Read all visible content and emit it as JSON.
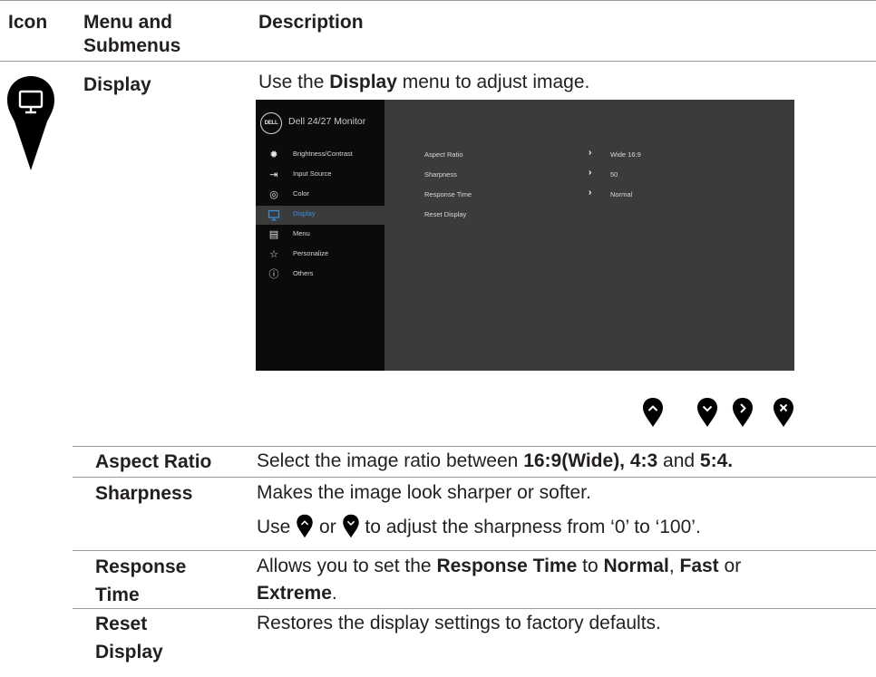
{
  "header": {
    "col_icon": "Icon",
    "col_menu": "Menu and Submenus",
    "col_desc": "Description"
  },
  "display": {
    "name": "Display",
    "icon": "monitor-icon",
    "intro_pre": "Use the ",
    "intro_bold": "Display",
    "intro_post": " menu to adjust image."
  },
  "osd": {
    "logo": "DELL",
    "title": "Dell 24/27 Monitor",
    "menu": [
      {
        "label": "Brightness/Contrast",
        "icon": "sun-icon"
      },
      {
        "label": "Input Source",
        "icon": "input-icon"
      },
      {
        "label": "Color",
        "icon": "palette-icon"
      },
      {
        "label": "Display",
        "icon": "monitor-icon",
        "selected": true
      },
      {
        "label": "Menu",
        "icon": "list-icon"
      },
      {
        "label": "Personalize",
        "icon": "star-icon"
      },
      {
        "label": "Others",
        "icon": "info-icon"
      }
    ],
    "settings": [
      {
        "label": "Aspect Ratio",
        "value": "Wide 16:9"
      },
      {
        "label": "Sharpness",
        "value": "50"
      },
      {
        "label": "Response Time",
        "value": "Normal"
      },
      {
        "label": "Reset Display",
        "value": ""
      }
    ]
  },
  "nav_buttons": [
    "up-button-icon",
    "down-button-icon",
    "right-button-icon",
    "close-button-icon"
  ],
  "rows": {
    "aspect": {
      "label": "Aspect Ratio",
      "pre": "Select the image ratio between ",
      "b1": "16:9(Wide), 4:3",
      "mid": " and ",
      "b2": "5:4."
    },
    "sharp": {
      "label": "Sharpness",
      "line1": "Makes the image look sharper or softer.",
      "use": "Use ",
      "or": " or ",
      "post": " to adjust the sharpness from ‘0’ to ‘100’."
    },
    "response": {
      "label1": "Response",
      "label2": "Time",
      "pre": "Allows you to set the ",
      "b1": "Response Time",
      "to": " to ",
      "b2": "Normal",
      "comma": ", ",
      "b3": "Fast",
      "or": " or ",
      "b4": "Extreme",
      "end": "."
    },
    "reset": {
      "label1": "Reset",
      "label2": "Display",
      "desc": "Restores the display settings to factory defaults."
    }
  }
}
